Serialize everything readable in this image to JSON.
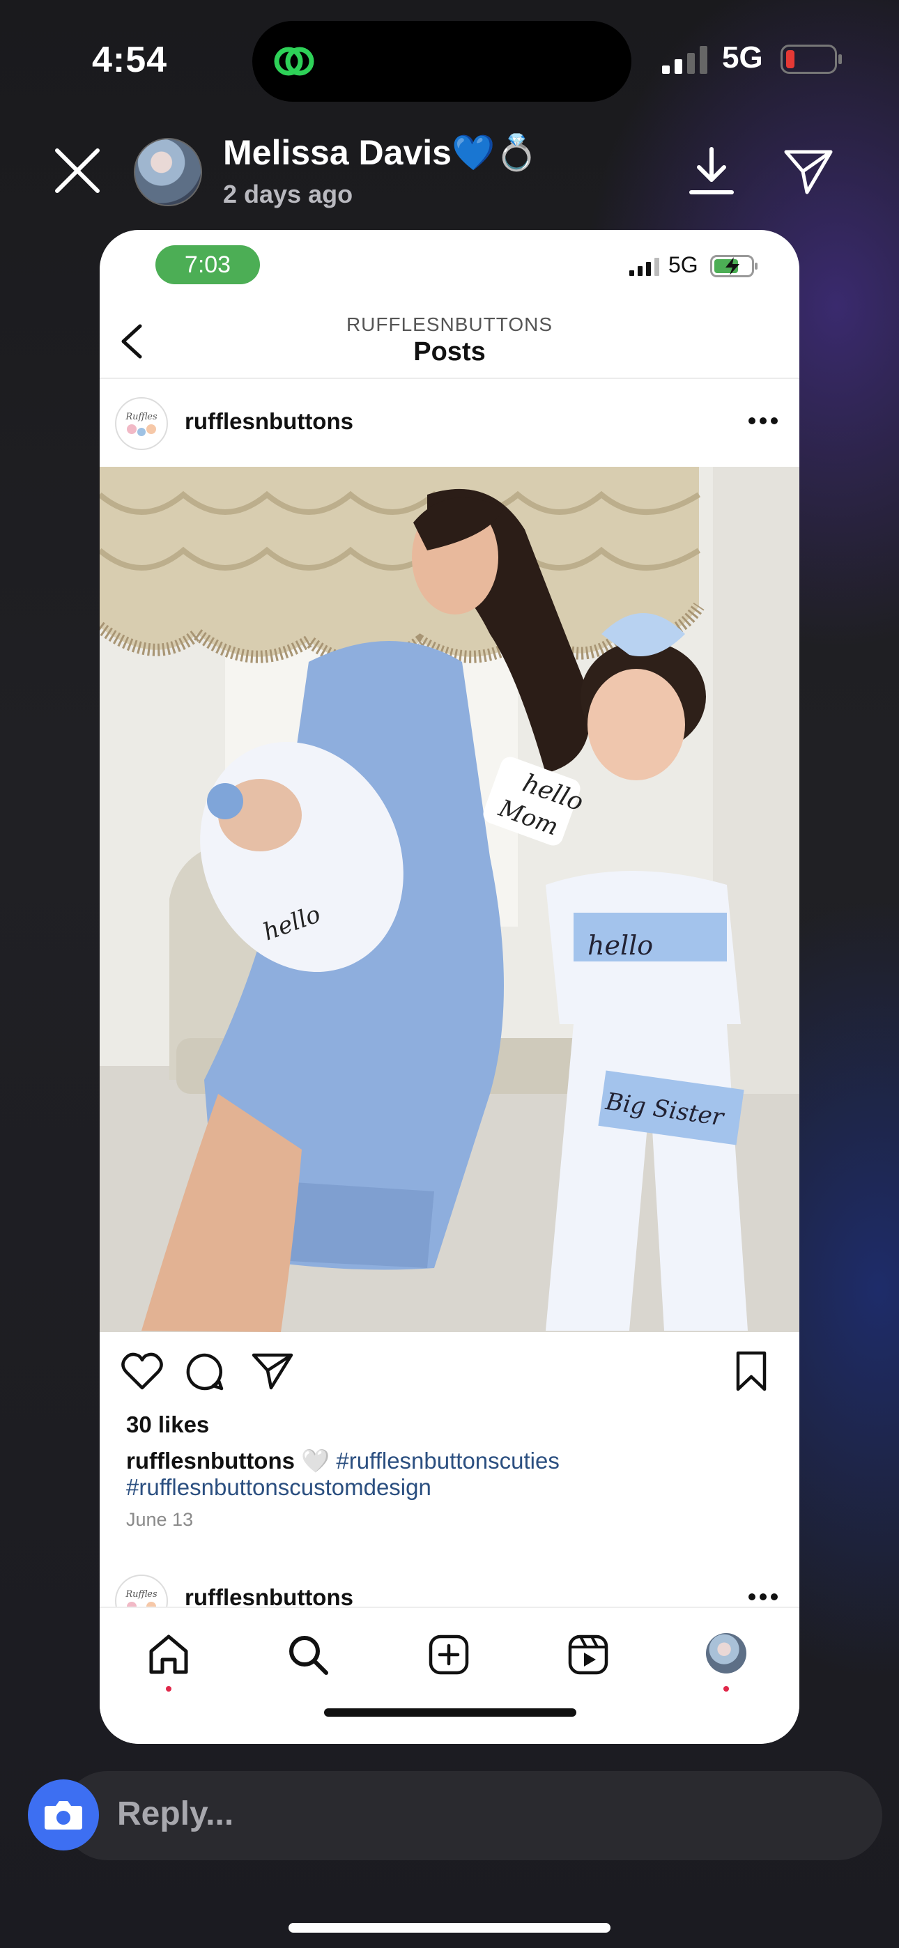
{
  "status_bar": {
    "time": "4:54",
    "network": "5G",
    "battery_color": "#e53935",
    "call_icon": "call-active-icon"
  },
  "story": {
    "user_name": "Melissa Davis",
    "user_emoji_heart": "💙",
    "user_emoji_ring": "💍",
    "age": "2 days ago"
  },
  "inner": {
    "status": {
      "time": "7:03",
      "network": "5G",
      "time_pill_color": "#4cae55"
    },
    "nav": {
      "subtitle": "RUFFLESNBUTTONS",
      "title": "Posts"
    },
    "post": {
      "username": "rufflesnbuttons",
      "likes": "30 likes",
      "caption_user": "rufflesnbuttons",
      "caption_emoji": "🤍",
      "hashtag_1": "#rufflesnbuttonscuties",
      "hashtag_2": "#rufflesnbuttonscustomdesign",
      "date": "June 13",
      "photo_texts": {
        "mom": "Mom",
        "hello": "hello",
        "sister": "Big Sister"
      }
    },
    "next_post": {
      "username": "rufflesnbuttons"
    },
    "tabs": [
      "home-icon",
      "search-icon",
      "create-icon",
      "reels-icon",
      "profile-avatar"
    ]
  },
  "reply": {
    "placeholder": "Reply..."
  }
}
